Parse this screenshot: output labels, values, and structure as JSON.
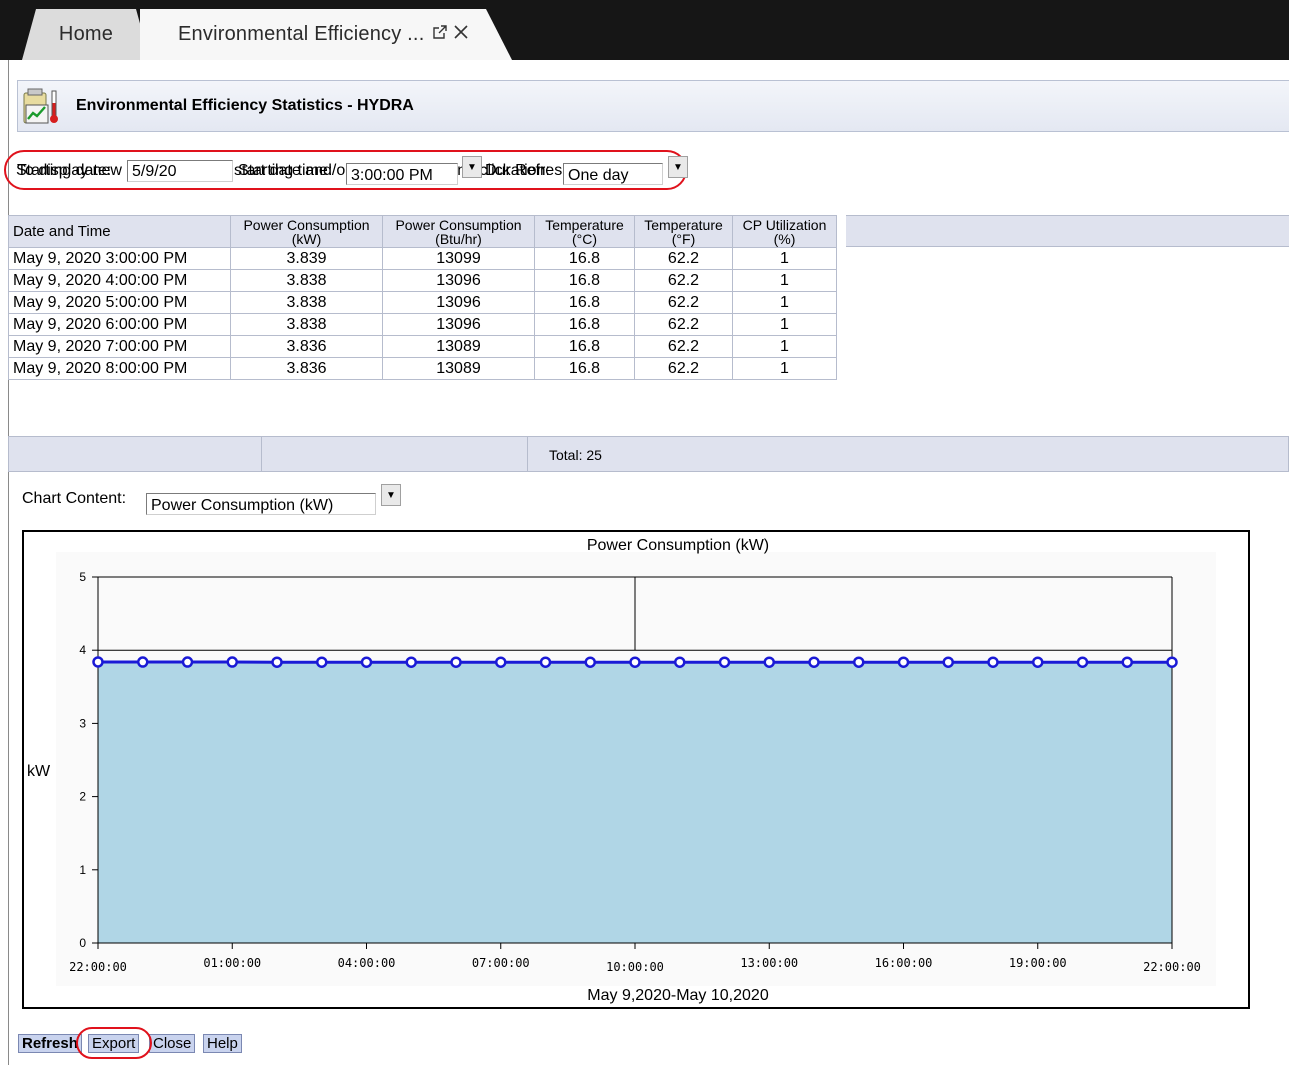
{
  "tabs": {
    "home": "Home",
    "active": "Environmental Efficiency ..."
  },
  "header": {
    "title": "Environmental Efficiency Statistics - HYDRA",
    "icon": "efficiency-chart-icon"
  },
  "instructions": "To display new data, enter the start date and/or the duration, and click Refresh.",
  "params": {
    "start_date_label": "Starting date:",
    "start_date_value": "5/9/20",
    "start_time_label": "Starting time:",
    "start_time_value": "3:00:00 PM",
    "duration_label": "Duration:",
    "duration_value": "One day"
  },
  "table": {
    "columns": [
      {
        "line1": "Date and Time",
        "line2": ""
      },
      {
        "line1": "Power Consumption",
        "line2": "(kW)"
      },
      {
        "line1": "Power Consumption",
        "line2": "(Btu/hr)"
      },
      {
        "line1": "Temperature",
        "line2": "(°C)"
      },
      {
        "line1": "Temperature",
        "line2": "(°F)"
      },
      {
        "line1": "CP Utilization",
        "line2": "(%)"
      }
    ],
    "rows": [
      [
        "May 9, 2020 3:00:00 PM",
        "3.839",
        "13099",
        "16.8",
        "62.2",
        "1"
      ],
      [
        "May 9, 2020 4:00:00 PM",
        "3.838",
        "13096",
        "16.8",
        "62.2",
        "1"
      ],
      [
        "May 9, 2020 5:00:00 PM",
        "3.838",
        "13096",
        "16.8",
        "62.2",
        "1"
      ],
      [
        "May 9, 2020 6:00:00 PM",
        "3.838",
        "13096",
        "16.8",
        "62.2",
        "1"
      ],
      [
        "May 9, 2020 7:00:00 PM",
        "3.836",
        "13089",
        "16.8",
        "62.2",
        "1"
      ],
      [
        "May 9, 2020 8:00:00 PM",
        "3.836",
        "13089",
        "16.8",
        "62.2",
        "1"
      ]
    ],
    "total": "Total: 25"
  },
  "chart_content": {
    "label": "Chart Content:",
    "selected": "Power Consumption (kW)"
  },
  "chart_data": {
    "type": "area",
    "title": "Power Consumption (kW)",
    "xlabel": "May 9,2020-May 10,2020",
    "ylabel": "kW",
    "ylim": [
      0,
      5
    ],
    "yticks": [
      "0",
      "1",
      "2",
      "3",
      "4",
      "5"
    ],
    "xtick_labels": [
      "22:00:00",
      "01:00:00",
      "04:00:00",
      "07:00:00",
      "10:00:00",
      "13:00:00",
      "16:00:00",
      "19:00:00",
      "22:00:00"
    ],
    "x_range_hours": [
      0,
      24
    ],
    "series": [
      {
        "values": [
          3.839,
          3.838,
          3.838,
          3.838,
          3.836,
          3.836,
          3.836,
          3.836,
          3.836,
          3.836,
          3.836,
          3.836,
          3.836,
          3.836,
          3.836,
          3.836,
          3.836,
          3.836,
          3.836,
          3.836,
          3.836,
          3.836,
          3.836,
          3.836,
          3.836
        ]
      }
    ],
    "colors": {
      "line": "#1a1ad6",
      "fill": "#b0d6e6"
    },
    "grid": false
  },
  "buttons": {
    "refresh": "Refresh",
    "export": "Export",
    "close": "Close",
    "help": "Help"
  }
}
